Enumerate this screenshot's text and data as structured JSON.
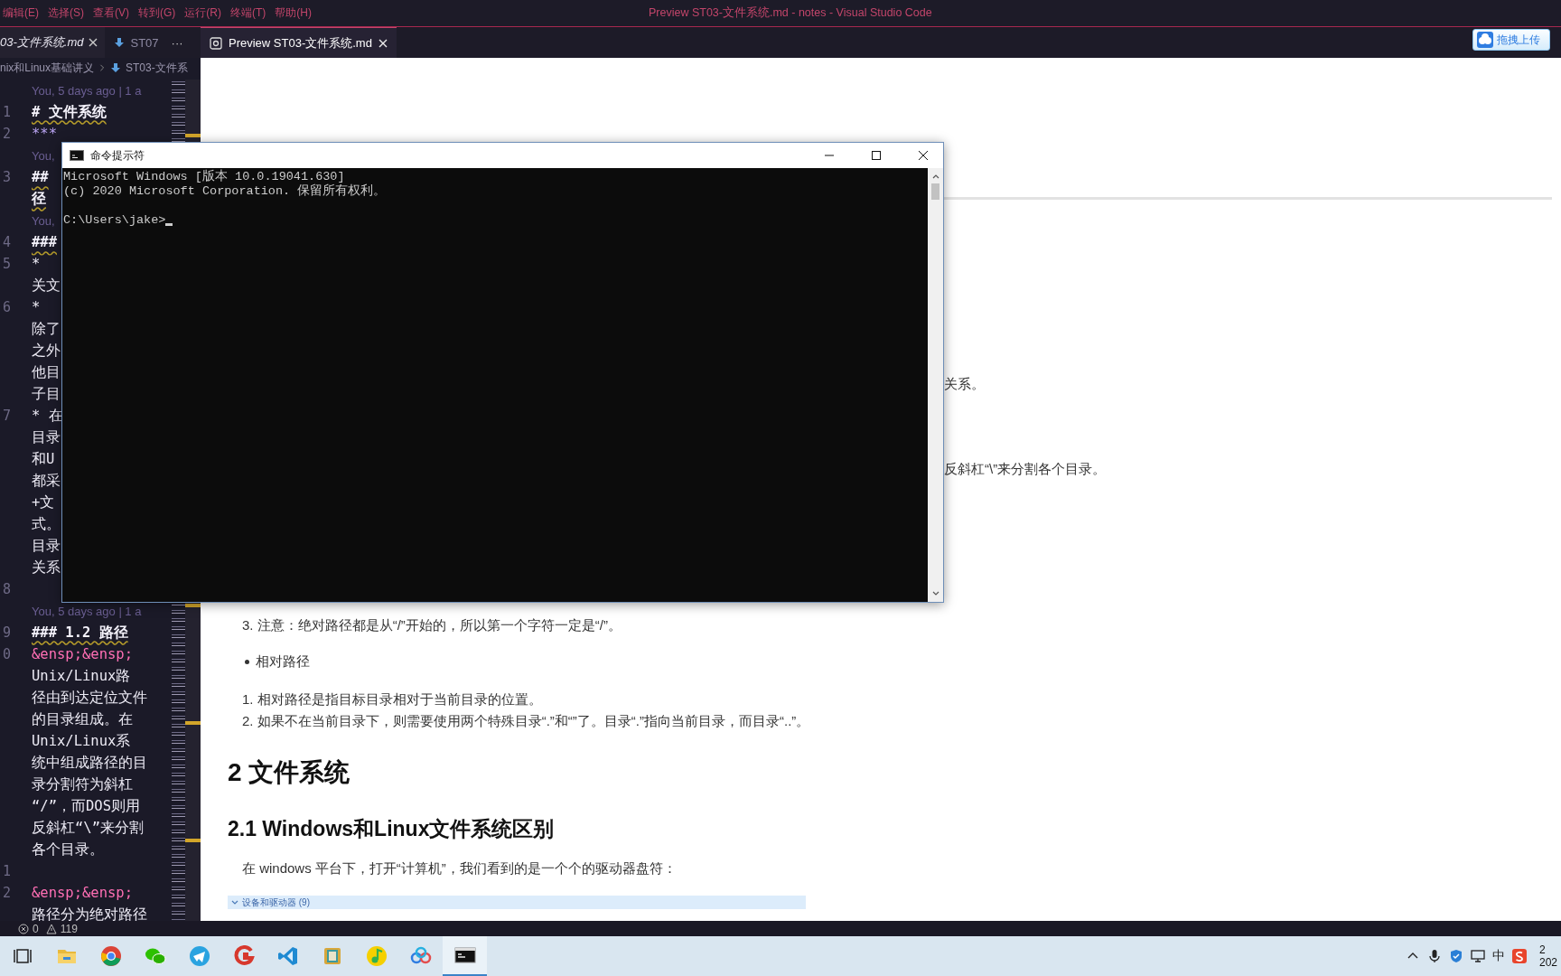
{
  "title_bar": {
    "menus": [
      "编辑(E)",
      "选择(S)",
      "查看(V)",
      "转到(G)",
      "运行(R)",
      "终端(T)",
      "帮助(H)"
    ],
    "title": "Preview ST03-文件系统.md - notes - Visual Studio Code"
  },
  "editor_tabs": [
    {
      "label": "03-文件系统.md",
      "kind": "markdown",
      "selected": true
    },
    {
      "label": "ST07",
      "kind": "download",
      "selected": false
    }
  ],
  "tab_overflow": "···",
  "breadcrumb": [
    "nix和Linux基础讲义",
    "ST03-文件系"
  ],
  "editor_lines": [
    {
      "kind": "blame",
      "text": "You, 5 days ago | 1 a"
    },
    {
      "kind": "heading",
      "number": "1",
      "text": "# 文件系统"
    },
    {
      "kind": "rule",
      "number": "2",
      "text": "***"
    },
    {
      "kind": "blame",
      "text": "You,"
    },
    {
      "kind": "heading",
      "number": "3",
      "text": "##"
    },
    {
      "kind": "heading",
      "text": "径"
    },
    {
      "kind": "blame",
      "text": "You,"
    },
    {
      "kind": "heading",
      "number": "4",
      "text": "###"
    },
    {
      "kind": "text",
      "number": "5",
      "text": "*"
    },
    {
      "kind": "text",
      "text": "关文"
    },
    {
      "kind": "text",
      "number": "6",
      "text": "*"
    },
    {
      "kind": "text",
      "text": "除了"
    },
    {
      "kind": "text",
      "text": "之外"
    },
    {
      "kind": "text",
      "text": "他目"
    },
    {
      "kind": "text",
      "text": "子目"
    },
    {
      "kind": "text",
      "number": "7",
      "text": "* 在"
    },
    {
      "kind": "text",
      "text": "目录"
    },
    {
      "kind": "text",
      "text": "和U"
    },
    {
      "kind": "text",
      "text": "都采"
    },
    {
      "kind": "text",
      "text": "+文"
    },
    {
      "kind": "text",
      "text": "式。"
    },
    {
      "kind": "text",
      "text": "目录"
    },
    {
      "kind": "text",
      "text": "关系"
    },
    {
      "kind": "blank",
      "number": "8"
    },
    {
      "kind": "blame",
      "text": "You, 5 days ago | 1 a"
    },
    {
      "kind": "heading",
      "number": "9",
      "text": "### 1.2 路径"
    },
    {
      "kind": "entity",
      "number": "0",
      "text": "&ensp;&ensp;"
    },
    {
      "kind": "text",
      "text": "Unix/Linux路"
    },
    {
      "kind": "text",
      "text": "径由到达定位文件"
    },
    {
      "kind": "text",
      "text": "的目录组成。在"
    },
    {
      "kind": "text",
      "text": "Unix/Linux系"
    },
    {
      "kind": "text",
      "text": "统中组成路径的目"
    },
    {
      "kind": "text",
      "text": "录分割符为斜杠"
    },
    {
      "kind": "text",
      "text": "“/”，而DOS则用"
    },
    {
      "kind": "text",
      "text": "反斜杠“\\”来分割"
    },
    {
      "kind": "text",
      "text": "各个目录。"
    },
    {
      "kind": "blank",
      "number": "1"
    },
    {
      "kind": "entity",
      "number": "2",
      "text": "&ensp;&ensp;"
    },
    {
      "kind": "text",
      "text": "路径分为绝对路径"
    }
  ],
  "preview_tab": {
    "label": "Preview ST03-文件系统.md",
    "selected": true
  },
  "upload_button": "拖拽上传",
  "preview": {
    "blocks": [
      {
        "kind": "rule"
      },
      {
        "kind": "tail",
        "text": "关系。"
      },
      {
        "kind": "tail",
        "text": "反斜杠“\\”来分割各个目录。"
      },
      {
        "kind": "li",
        "text": "3. 注意：绝对路径都是从“/”开始的，所以第一个字符一定是“/”。"
      },
      {
        "kind": "bullet",
        "text": "相对路径"
      },
      {
        "kind": "li",
        "text": "1. 相对路径是指目标目录相对于当前目录的位置。"
      },
      {
        "kind": "li",
        "text": "2. 如果不在当前目录下，则需要使用两个特殊目录“.”和“”了。目录“.”指向当前目录，而目录“..”。"
      },
      {
        "kind": "h2",
        "text": "2 文件系统"
      },
      {
        "kind": "h3",
        "text": "2.1 Windows和Linux文件系统区别"
      },
      {
        "kind": "p",
        "text": "在 windows 平台下，打开“计算机”，我们看到的是一个个的驱动器盘符："
      },
      {
        "kind": "image",
        "text": "设备和驱动器 (9)"
      }
    ]
  },
  "cmd": {
    "title": "命令提示符",
    "lines": [
      "Microsoft Windows [版本 10.0.19041.630]",
      "(c) 2020 Microsoft Corporation. 保留所有权利。"
    ],
    "prompt": "C:\\Users\\jake>"
  },
  "status_bar": {
    "errors": "0",
    "warnings": "119"
  },
  "taskbar": {
    "apps": [
      {
        "kind": "taskview",
        "selected": false
      },
      {
        "kind": "folder",
        "selected": false
      },
      {
        "kind": "wheel",
        "selected": false
      },
      {
        "kind": "chat",
        "selected": false
      },
      {
        "kind": "plane",
        "selected": false
      },
      {
        "kind": "swirl",
        "selected": false
      },
      {
        "kind": "ribbon",
        "selected": false
      },
      {
        "kind": "book",
        "selected": false
      },
      {
        "kind": "note",
        "selected": false
      },
      {
        "kind": "cloud",
        "selected": false
      },
      {
        "kind": "terminal",
        "selected": true
      }
    ],
    "ime": "中",
    "clock": {
      "time": "2",
      "date": "202"
    }
  }
}
